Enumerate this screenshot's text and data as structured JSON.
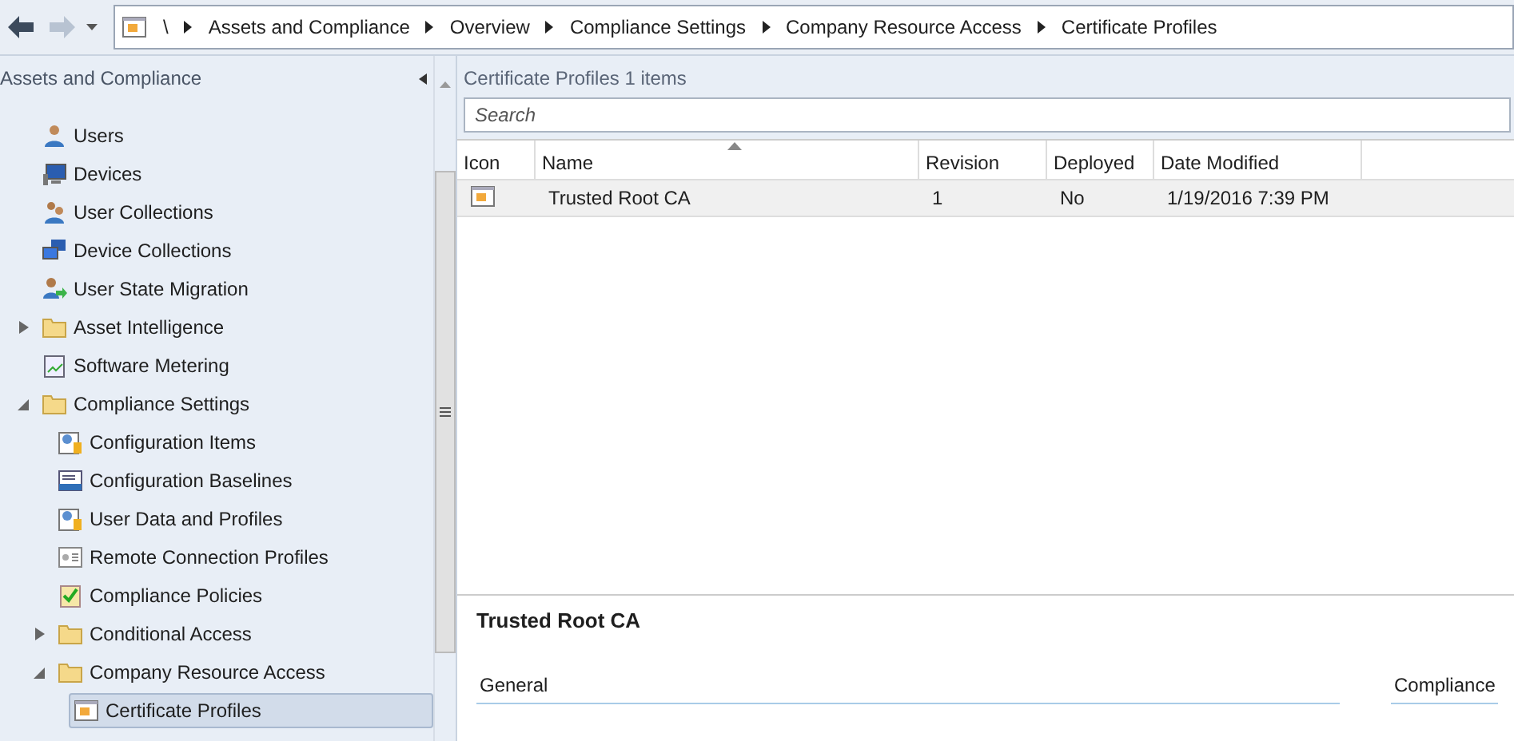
{
  "breadcrumb": {
    "root": "\\",
    "segments": [
      "Assets and Compliance",
      "Overview",
      "Compliance Settings",
      "Company Resource Access",
      "Certificate Profiles"
    ]
  },
  "navigation": {
    "title": "Assets and Compliance",
    "items": [
      {
        "label": "Users",
        "kind": "user",
        "selected": false
      },
      {
        "label": "Devices",
        "kind": "device",
        "selected": false
      },
      {
        "label": "User Collections",
        "kind": "users",
        "selected": false
      },
      {
        "label": "Device Collections",
        "kind": "devices",
        "selected": false
      },
      {
        "label": "User State Migration",
        "kind": "migration",
        "selected": false
      },
      {
        "label": "Asset Intelligence",
        "kind": "folder",
        "selected": false,
        "expanded": false
      },
      {
        "label": "Software Metering",
        "kind": "meter",
        "selected": false
      },
      {
        "label": "Compliance Settings",
        "kind": "folder",
        "selected": false,
        "expanded": true,
        "children": [
          {
            "label": "Configuration Items",
            "kind": "config",
            "selected": false
          },
          {
            "label": "Configuration Baselines",
            "kind": "baseline",
            "selected": false
          },
          {
            "label": "User Data and Profiles",
            "kind": "config",
            "selected": false
          },
          {
            "label": "Remote Connection Profiles",
            "kind": "remote",
            "selected": false
          },
          {
            "label": "Compliance Policies",
            "kind": "policy",
            "selected": false
          },
          {
            "label": "Conditional Access",
            "kind": "folder",
            "selected": false,
            "expanded": false
          },
          {
            "label": "Company Resource Access",
            "kind": "folder",
            "selected": false,
            "expanded": true,
            "children": [
              {
                "label": "Certificate Profiles",
                "kind": "certificate",
                "selected": true
              }
            ]
          }
        ]
      }
    ]
  },
  "list": {
    "title": "Certificate Profiles",
    "count": "1 items",
    "search": {
      "placeholder": "Search"
    },
    "columns": [
      {
        "label": "Icon",
        "sorted": false
      },
      {
        "label": "Name",
        "sorted": true
      },
      {
        "label": "Revision",
        "sorted": false
      },
      {
        "label": "Deployed",
        "sorted": false
      },
      {
        "label": "Date Modified",
        "sorted": false
      }
    ],
    "rows": [
      {
        "name": "Trusted Root CA",
        "revision": "1",
        "deployed": "No",
        "date_modified": "1/19/2016 7:39 PM",
        "selected": true
      }
    ]
  },
  "details": {
    "title": "Trusted Root CA",
    "sections": [
      "General",
      "Compliance"
    ]
  }
}
